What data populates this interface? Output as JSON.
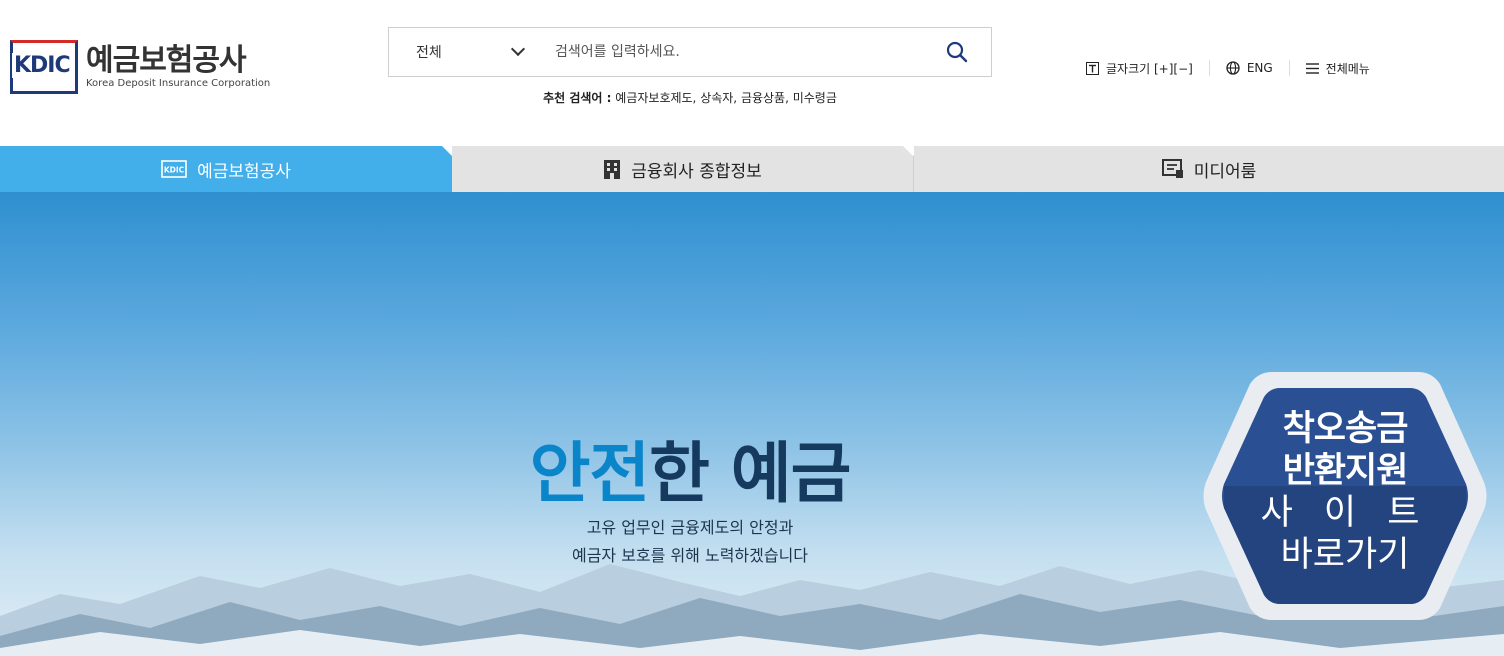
{
  "logo": {
    "mark": "KDIC",
    "name_ko": "예금보험공사",
    "name_en": "Korea Deposit Insurance Corporation"
  },
  "search": {
    "scope_selected": "전체",
    "placeholder": "검색어를 입력하세요.",
    "recommend_label": "추천 검색어 :",
    "recommend_keywords": "예금자보호제도, 상속자, 금융상품, 미수령금"
  },
  "utils": {
    "font_size": "글자크기 [+][−]",
    "lang": "ENG",
    "all_menu": "전체메뉴"
  },
  "nav": {
    "tabs": [
      {
        "label": "예금보험공사",
        "icon": "kdic-logo-icon",
        "active": true
      },
      {
        "label": "금융회사 종합정보",
        "icon": "building-icon",
        "active": false
      },
      {
        "label": "미디어룸",
        "icon": "media-icon",
        "active": false
      }
    ]
  },
  "hero": {
    "title_highlight": "안전",
    "title_rest": "한 예금",
    "sub_line1": "고유 업무인 금융제도의 안정과",
    "sub_line2": "예금자 보호를 위해 노력하겠습니다"
  },
  "badge": {
    "line1": "착오송금",
    "line2": "반환지원",
    "line3": "사 이 트",
    "line4": "바로가기"
  },
  "colors": {
    "accent": "#42aeea",
    "navy": "#1d3b7a",
    "badge": "#2a4f93",
    "title_blue": "#0a85c9"
  }
}
